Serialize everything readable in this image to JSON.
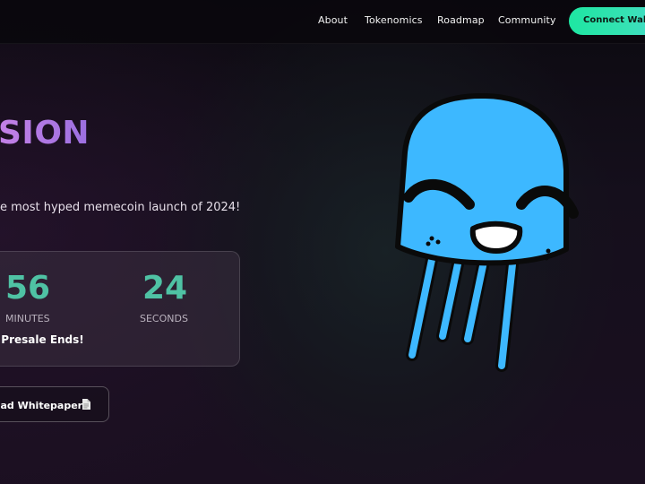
{
  "nav": {
    "links": [
      "About",
      "Tokenomics",
      "Roadmap",
      "Community"
    ],
    "connect_label": "Connect Wallet"
  },
  "hero": {
    "title": "SION",
    "tagline": "e most hyped memecoin launch of 2024!"
  },
  "countdown": {
    "minutes_value": "56",
    "minutes_label": "MINUTES",
    "seconds_value": "24",
    "seconds_label": "SECONDS",
    "caption": "l Presale Ends!"
  },
  "whitepaper": {
    "label": "ead Whitepaper"
  },
  "mascot": {
    "icon": "jellyfish-mascot",
    "body_color": "#3db8ff",
    "outline_color": "#0a0a0a"
  },
  "colors": {
    "accent_green": "#1ee6a2",
    "accent_purple": "#b47ae0",
    "countdown_teal": "#4fc2a4"
  }
}
